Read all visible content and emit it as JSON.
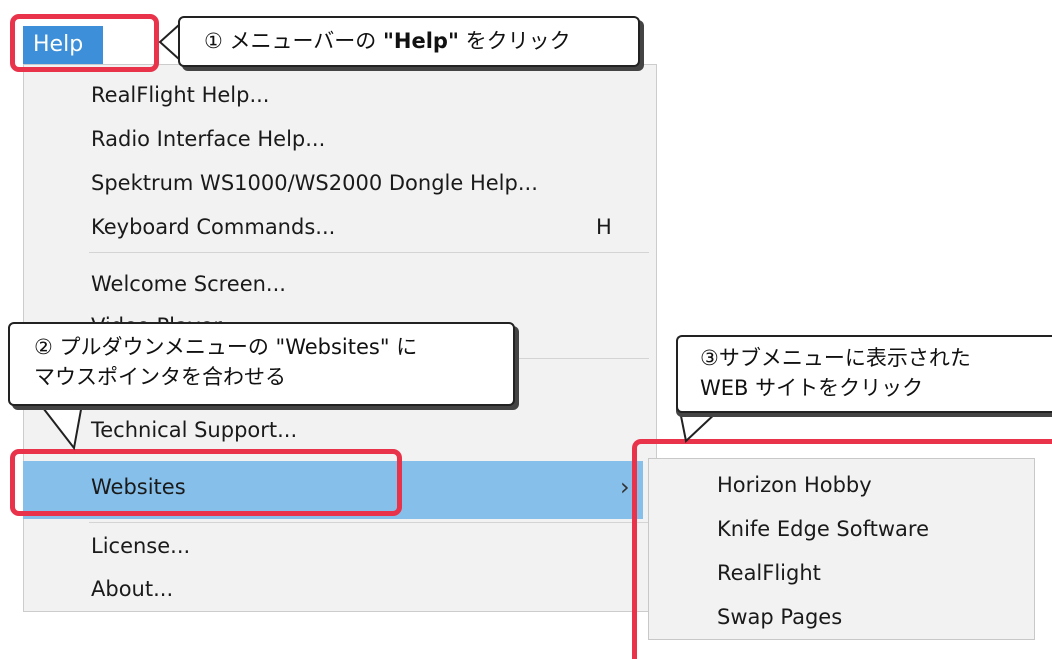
{
  "menubar": {
    "help_label": "Help"
  },
  "dropdown": {
    "items": [
      {
        "label": "RealFlight Help..."
      },
      {
        "label": "Radio Interface Help..."
      },
      {
        "label": "Spektrum WS1000/WS2000 Dongle Help..."
      },
      {
        "label": "Keyboard Commands...",
        "shortcut": "H"
      },
      {
        "label": "Welcome Screen..."
      },
      {
        "label": "Video Player..."
      },
      {
        "label": "Technical Support..."
      },
      {
        "label": "Websites",
        "submenu_arrow": "›"
      },
      {
        "label": "License..."
      },
      {
        "label": "About..."
      }
    ]
  },
  "submenu": {
    "items": [
      {
        "label": "Horizon Hobby"
      },
      {
        "label": "Knife Edge Software"
      },
      {
        "label": "RealFlight"
      },
      {
        "label": "Swap Pages"
      }
    ]
  },
  "callouts": {
    "c1_pre": "① メニューバーの ",
    "c1_bold": "\"Help\"",
    "c1_post": " をクリック",
    "c2_line1": "② プルダウンメニューの \"Websites\" に",
    "c2_line2": "マウスポインタを合わせる",
    "c3_line1": "③サブメニューに表示された",
    "c3_line2": "WEB サイトをクリック"
  },
  "colors": {
    "highlight": "#86bfea",
    "annotation_red": "#e8334a",
    "menu_active": "#3c8fd8"
  }
}
